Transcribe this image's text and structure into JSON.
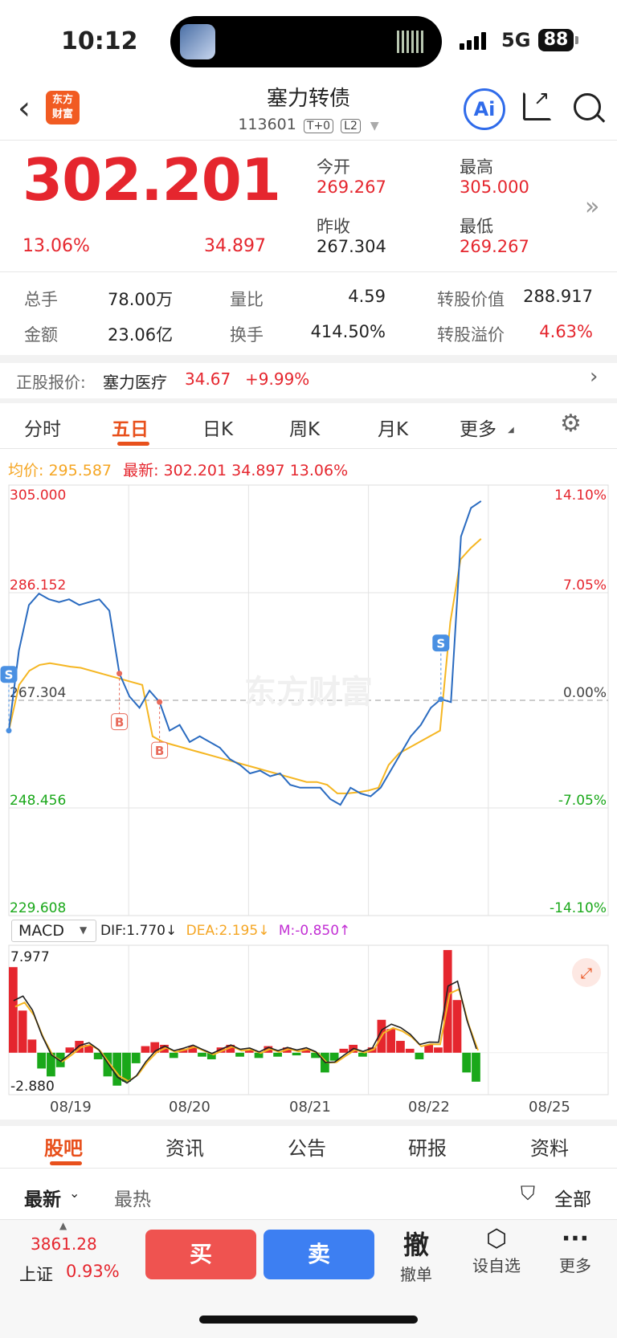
{
  "status_bar": {
    "time": "10:12",
    "network": "5G",
    "battery": "88"
  },
  "header": {
    "logo_line1": "东方",
    "logo_line2": "财富",
    "title": "塞力转债",
    "code": "113601",
    "tag1": "T+0",
    "tag2": "L2",
    "ai_label": "Ai"
  },
  "quote": {
    "price": "302.201",
    "change_pct": "13.06%",
    "change_amt": "34.897",
    "open_label": "今开",
    "open": "269.267",
    "high_label": "最高",
    "high": "305.000",
    "prev_close_label": "昨收",
    "prev_close": "267.304",
    "low_label": "最低",
    "low": "269.267"
  },
  "stats": {
    "volume_label": "总手",
    "volume": "78.00万",
    "vol_ratio_label": "量比",
    "vol_ratio": "4.59",
    "conv_value_label": "转股价值",
    "conv_value": "288.917",
    "amount_label": "金额",
    "amount": "23.06亿",
    "turnover_label": "换手",
    "turnover": "414.50%",
    "conv_premium_label": "转股溢价",
    "conv_premium": "4.63%"
  },
  "underlying": {
    "label": "正股报价:",
    "name": "塞力医疗",
    "price": "34.67",
    "change": "+9.99%"
  },
  "chart_tabs": [
    "分时",
    "五日",
    "日K",
    "周K",
    "月K",
    "更多"
  ],
  "active_tab": "五日",
  "legend": {
    "avg_label": "均价:",
    "avg": "295.587",
    "latest_label": "最新:",
    "latest": "302.201",
    "latest_chg": "34.897",
    "latest_pct": "13.06%"
  },
  "watermark": "东方财富",
  "chart_data": {
    "type": "line",
    "title": "",
    "y_left_ticks": [
      "305.000",
      "286.152",
      "267.304",
      "248.456",
      "229.608"
    ],
    "y_right_ticks": [
      "14.10%",
      "7.05%",
      "0.00%",
      "-7.05%",
      "-14.10%"
    ],
    "ylim": [
      229.608,
      305.0
    ],
    "baseline": 267.304,
    "x_ticks": [
      "08/19",
      "08/20",
      "08/21",
      "08/22",
      "08/25"
    ],
    "series": [
      {
        "values": [
          262,
          276,
          284,
          286,
          285,
          284.5,
          285,
          284,
          284.5,
          285,
          283,
          272,
          268,
          266,
          269,
          267,
          262,
          263,
          260,
          261,
          260,
          259,
          257,
          256,
          254.5,
          255,
          254,
          254.5,
          252.5,
          252,
          252,
          252,
          250,
          249,
          252,
          251,
          250.5,
          252,
          255,
          258,
          261,
          263,
          266,
          267.5,
          267,
          296,
          301,
          302.2
        ]
      },
      {
        "values": [
          262,
          270,
          272.5,
          273.5,
          273.8,
          273.5,
          273.2,
          273,
          272.5,
          272,
          271.5,
          271,
          270.5,
          270,
          261,
          260,
          259.5,
          259,
          258.5,
          258,
          257.5,
          257,
          256.5,
          256,
          255.5,
          255,
          254.5,
          254,
          253.5,
          253,
          253,
          252.5,
          251,
          251,
          251.2,
          251.5,
          252,
          256,
          258,
          259,
          260,
          261,
          262,
          281,
          292,
          294,
          295.587
        ]
      }
    ],
    "markers": [
      {
        "label": "S",
        "x_index": 0
      },
      {
        "label": "B",
        "x_index": 11
      },
      {
        "label": "B",
        "x_index": 15
      },
      {
        "label": "S",
        "x_index": 43
      }
    ]
  },
  "macd": {
    "selector": "MACD",
    "dif_label": "DIF:1.770",
    "dea_label": "DEA:2.195",
    "m_label": "M:-0.850",
    "top_value": "7.977",
    "bottom_value": "-2.880",
    "histogram": [
      6.5,
      3.2,
      1.0,
      -1.2,
      -1.8,
      -1.1,
      0.4,
      0.9,
      0.6,
      -0.5,
      -1.8,
      -2.5,
      -2.2,
      -0.8,
      0.5,
      0.8,
      0.6,
      -0.4,
      0.3,
      0.5,
      -0.3,
      -0.5,
      0.4,
      0.6,
      -0.3,
      0.2,
      -0.4,
      0.5,
      -0.3,
      0.4,
      -0.2,
      0.3,
      -0.4,
      -1.5,
      -0.6,
      0.3,
      0.6,
      -0.3,
      0.4,
      2.5,
      1.8,
      0.9,
      0.3,
      -0.5,
      0.6,
      0.4,
      7.8,
      4.0,
      -1.5,
      -2.2
    ]
  },
  "bottom_tabs": [
    "股吧",
    "资讯",
    "公告",
    "研报",
    "资料"
  ],
  "active_bottom_tab": "股吧",
  "sort": {
    "latest": "最新",
    "hottest": "最热",
    "filter": "全部"
  },
  "footer": {
    "index_value": "3861.28",
    "index_name": "上证",
    "index_pct": "0.93%",
    "buy": "买",
    "sell": "卖",
    "cancel_icon": "撤",
    "cancel": "撤单",
    "watch": "设自选",
    "more": "更多"
  },
  "colors": {
    "up": "#e5262e",
    "down": "#1aa81a",
    "price_line": "#2a6bc0",
    "avg_line": "#f5b622",
    "accent": "#e8501c",
    "buy": "#ef5350",
    "sell": "#3d7ff2"
  }
}
